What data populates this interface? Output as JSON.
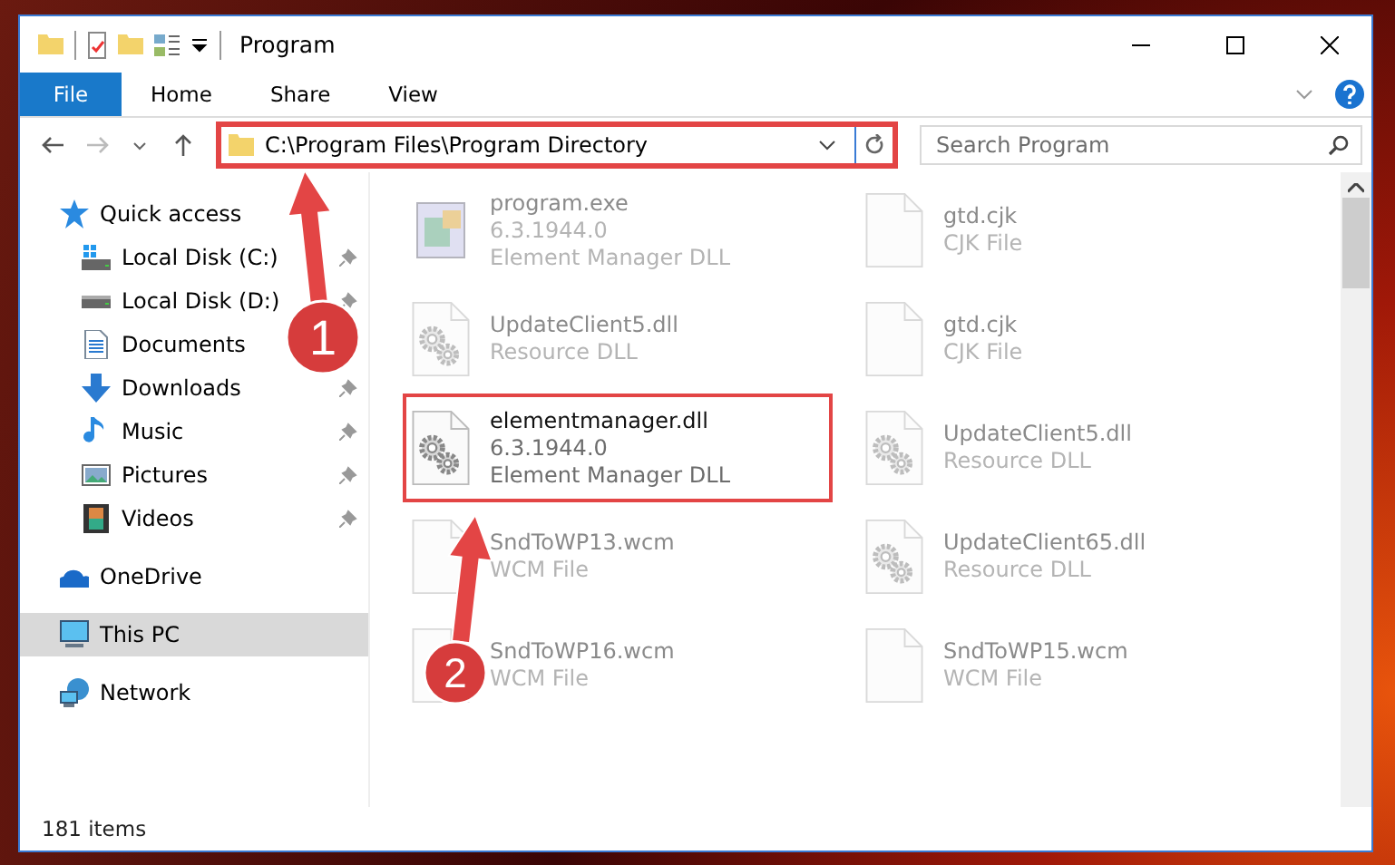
{
  "window": {
    "title": "Program"
  },
  "ribbon": {
    "tabs": [
      {
        "label": "File",
        "kind": "file",
        "selected": false
      },
      {
        "label": "Home",
        "kind": "tab",
        "selected": false
      },
      {
        "label": "Share",
        "kind": "tab",
        "selected": false
      },
      {
        "label": "View",
        "kind": "tab",
        "selected": false
      }
    ]
  },
  "address_bar": {
    "path": "C:\\Program Files\\Program Directory",
    "highlighted": true
  },
  "search": {
    "placeholder": "Search Program"
  },
  "navigation": [
    {
      "label": "Quick access",
      "selected": false,
      "children": [
        {
          "label": "Local Disk (C:)",
          "pinned": true
        },
        {
          "label": "Local Disk (D:)",
          "pinned": true
        },
        {
          "label": "Documents"
        },
        {
          "label": "Downloads",
          "pinned": true
        },
        {
          "label": "Music",
          "pinned": true
        },
        {
          "label": "Pictures",
          "pinned": true
        },
        {
          "label": "Videos",
          "pinned": true
        }
      ]
    },
    {
      "label": "OneDrive",
      "selected": false
    },
    {
      "label": "This PC",
      "selected": true
    },
    {
      "label": "Network",
      "selected": false
    }
  ],
  "files": [
    {
      "name": "program.exe",
      "details": [
        "6.3.1944.0",
        "Element Manager DLL"
      ],
      "kind": "exe",
      "blurred": true,
      "highlighted": false
    },
    {
      "name": "gtd.cjk",
      "details": [
        "CJK File"
      ],
      "kind": "file",
      "blurred": true,
      "highlighted": false
    },
    {
      "name": "UpdateClient5.dll",
      "details": [
        "Resource DLL"
      ],
      "kind": "dll",
      "blurred": true,
      "highlighted": false
    },
    {
      "name": "gtd.cjk",
      "details": [
        "CJK File"
      ],
      "kind": "file",
      "blurred": true,
      "highlighted": false
    },
    {
      "name": "elementmanager.dll",
      "details": [
        "6.3.1944.0",
        "Element Manager DLL"
      ],
      "kind": "dll",
      "blurred": false,
      "highlighted": true
    },
    {
      "name": "UpdateClient5.dll",
      "details": [
        "Resource DLL"
      ],
      "kind": "dll",
      "blurred": true,
      "highlighted": false
    },
    {
      "name": "SndToWP13.wcm",
      "details": [
        "WCM File"
      ],
      "kind": "file",
      "blurred": true,
      "highlighted": false
    },
    {
      "name": "UpdateClient65.dll",
      "details": [
        "Resource DLL"
      ],
      "kind": "dll",
      "blurred": true,
      "highlighted": false
    },
    {
      "name": "SndToWP16.wcm",
      "details": [
        "WCM File"
      ],
      "kind": "file",
      "blurred": true,
      "highlighted": false
    },
    {
      "name": "SndToWP15.wcm",
      "details": [
        "WCM File"
      ],
      "kind": "file",
      "blurred": true,
      "highlighted": false
    }
  ],
  "status_bar": {
    "item_count": "181 items"
  },
  "annotations": [
    {
      "number": "1"
    },
    {
      "number": "2"
    }
  ]
}
